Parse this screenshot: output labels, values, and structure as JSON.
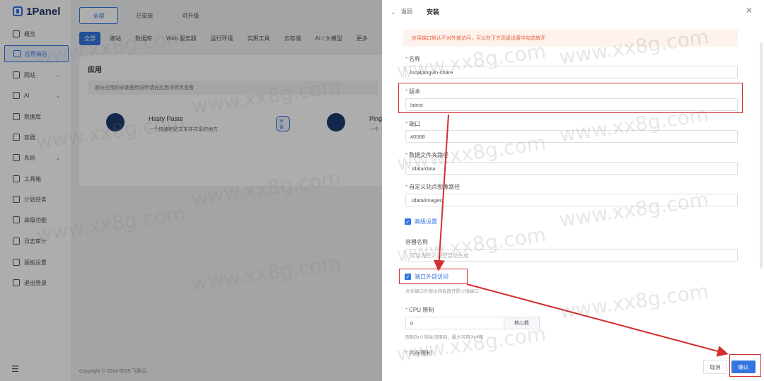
{
  "brand": {
    "name": "1Panel"
  },
  "sidebar": {
    "items": [
      {
        "label": "概览",
        "icon": "grid-icon",
        "has_chevron": false
      },
      {
        "label": "应用商店",
        "icon": "store-icon",
        "has_chevron": false,
        "active": true
      },
      {
        "label": "网站",
        "icon": "globe-icon",
        "has_chevron": true
      },
      {
        "label": "AI",
        "icon": "ai-icon",
        "has_chevron": true
      },
      {
        "label": "数据库",
        "icon": "database-icon",
        "has_chevron": false
      },
      {
        "label": "容器",
        "icon": "container-icon",
        "has_chevron": false
      },
      {
        "label": "系统",
        "icon": "system-icon",
        "has_chevron": true
      },
      {
        "label": "工具箱",
        "icon": "toolbox-icon",
        "has_chevron": false
      },
      {
        "label": "计划任务",
        "icon": "clock-icon",
        "has_chevron": false
      },
      {
        "label": "高级功能",
        "icon": "diamond-icon",
        "has_chevron": false
      },
      {
        "label": "日志审计",
        "icon": "log-icon",
        "has_chevron": false
      },
      {
        "label": "面板设置",
        "icon": "settings-icon",
        "has_chevron": false
      },
      {
        "label": "退出登录",
        "icon": "logout-icon",
        "has_chevron": false
      }
    ]
  },
  "main": {
    "top_tabs": [
      "全部",
      "已安装",
      "可升级"
    ],
    "categories": [
      "全部",
      "建站",
      "数据库",
      "Web 服务器",
      "运行环境",
      "实用工具",
      "云存储",
      "AI / 大模型",
      "更多"
    ],
    "section_title": "应用",
    "notice": "部分应用的安装使用说明请在应用详情页查看",
    "apps": [
      {
        "name": "Hasty Paste",
        "desc": "一个快速粘贴文本并共享的地方",
        "badge": "安装"
      },
      {
        "name": "Ping",
        "desc": "一个",
        "badge": ""
      }
    ],
    "footer": "Copyright © 2014-2025 飞致云"
  },
  "drawer": {
    "back_label": "返回",
    "title": "安装",
    "alert": "应用端口默认不对外部访问，可以在下方高级设置中勾选放开",
    "fields": [
      {
        "label": "名称",
        "value": "localpingvin-share",
        "required": true
      },
      {
        "label": "版本",
        "value": "latest",
        "required": true
      },
      {
        "label": "端口",
        "value": "40068",
        "required": true
      },
      {
        "label": "数据文件夹路径",
        "value": "./data/data",
        "required": true
      },
      {
        "label": "自定义站点图像路径",
        "value": "./data/images",
        "required": true
      }
    ],
    "advanced_label": "高级设置",
    "container_name_label": "容器名称",
    "container_name_placeholder": "可以为空，为空自动生成",
    "external_access_label": "端口外部访问",
    "external_access_hint": "允许端口外部访问会放开防火墙端口",
    "cpu_label": "CPU 限制",
    "cpu_value": "0",
    "cpu_unit": "核心数",
    "cpu_hint": "限制为 0 则关闭限制，最大可用为 4核",
    "memory_label": "内存限制",
    "cancel_label": "取消",
    "confirm_label": "确认"
  },
  "watermark": "www.xx8g.com",
  "colors": {
    "primary": "#3375e0",
    "annotation": "#d32f2f",
    "alert_text": "#e6623c"
  }
}
